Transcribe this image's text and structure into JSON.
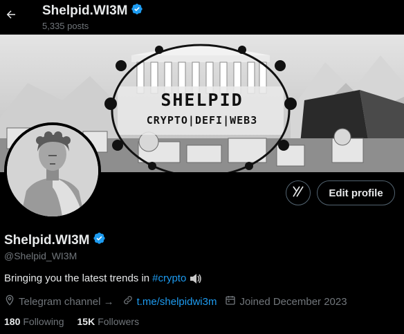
{
  "header": {
    "name": "Shelpid.WI3M",
    "posts": "5,335 posts"
  },
  "banner": {
    "title": "SHELPID",
    "subtitle": "CRYPTO|DEFI|WEB3"
  },
  "actions": {
    "edit_profile_label": "Edit profile"
  },
  "profile": {
    "display_name": "Shelpid.WI3M",
    "handle": "@Shelpid_WI3M",
    "bio_text": "Bringing you the latest trends in",
    "bio_hashtag": "#crypto",
    "location": "Telegram channel →",
    "website": "t.me/shelpidwi3m",
    "joined": "Joined December 2023"
  },
  "stats": {
    "following_count": "180",
    "following_label": "Following",
    "followers_count": "15K",
    "followers_label": "Followers"
  },
  "colors": {
    "accent": "#1d9bf0",
    "verified": "#1d9bf0",
    "muted_text": "#71767b",
    "background": "#000000"
  }
}
